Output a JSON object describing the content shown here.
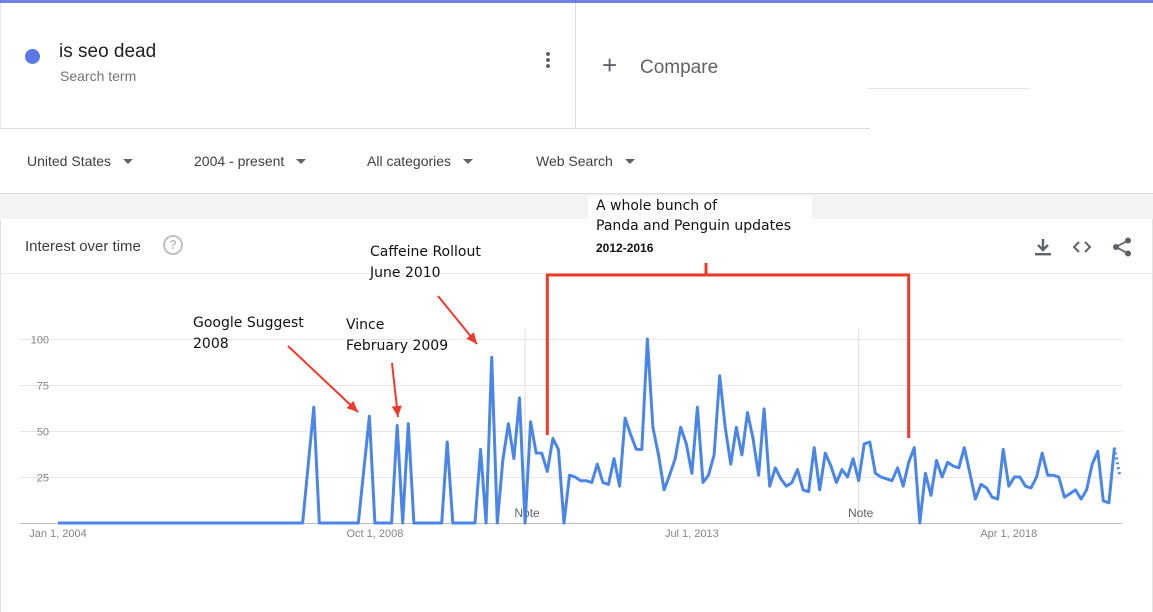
{
  "search_term": {
    "title": "is seo dead",
    "subtitle": "Search term",
    "color": "#5a79e6",
    "menu_icon": "more-vert-icon"
  },
  "compare": {
    "label": "Compare",
    "icon": "plus-icon"
  },
  "filters": [
    {
      "label": "United States"
    },
    {
      "label": "2004 - present"
    },
    {
      "label": "All categories"
    },
    {
      "label": "Web Search"
    }
  ],
  "card": {
    "title": "Interest over time",
    "help_icon": "help-icon",
    "tools": [
      "download-icon",
      "embed-code-icon",
      "share-icon"
    ]
  },
  "annotations": {
    "google_suggest": [
      "Google Suggest",
      "2008"
    ],
    "vince": [
      "Vince",
      "February 2009"
    ],
    "caffeine": [
      "Caffeine Rollout",
      "June 2010"
    ],
    "panda": [
      "A whole bunch of",
      "Panda and Penguin updates"
    ],
    "panda_years": "2012-2016",
    "arrow_color": "#ee3a2a"
  },
  "chart_data": {
    "type": "line",
    "title": "",
    "xlabel": "",
    "ylabel": "",
    "ylim": [
      0,
      100
    ],
    "y_ticks": [
      25,
      50,
      75,
      100
    ],
    "x_ticks": [
      "Jan 1, 2004",
      "Oct 1, 2008",
      "Jul 1, 2013",
      "Apr 1, 2018"
    ],
    "x_range": [
      "2004-01",
      "2019-05"
    ],
    "grid": true,
    "line_color": "#4a86e8",
    "notes": [
      {
        "label": "Note",
        "date": "2011-01"
      },
      {
        "label": "Note",
        "date": "2016-01"
      }
    ],
    "series": [
      {
        "points": [
          [
            "2004-01",
            0
          ],
          [
            "2007-09",
            0
          ],
          [
            "2007-11",
            63
          ],
          [
            "2007-12",
            0
          ],
          [
            "2008-07",
            0
          ],
          [
            "2008-09",
            58
          ],
          [
            "2008-10",
            0
          ],
          [
            "2009-01",
            0
          ],
          [
            "2009-02",
            53
          ],
          [
            "2009-03",
            0
          ],
          [
            "2009-04",
            54
          ],
          [
            "2009-05",
            0
          ],
          [
            "2009-10",
            0
          ],
          [
            "2009-11",
            44
          ],
          [
            "2009-12",
            0
          ],
          [
            "2010-04",
            0
          ],
          [
            "2010-05",
            40
          ],
          [
            "2010-06",
            0
          ],
          [
            "2010-07",
            90
          ],
          [
            "2010-08",
            0
          ],
          [
            "2010-09",
            34
          ],
          [
            "2010-10",
            54
          ],
          [
            "2010-11",
            35
          ],
          [
            "2010-12",
            68
          ],
          [
            "2011-01",
            0
          ],
          [
            "2011-02",
            55
          ],
          [
            "2011-03",
            38
          ],
          [
            "2011-04",
            38
          ],
          [
            "2011-05",
            28
          ],
          [
            "2011-06",
            46
          ],
          [
            "2011-07",
            40
          ],
          [
            "2011-08",
            0
          ],
          [
            "2011-09",
            26
          ],
          [
            "2011-10",
            25
          ],
          [
            "2011-11",
            23
          ],
          [
            "2011-12",
            23
          ],
          [
            "2012-01",
            22
          ],
          [
            "2012-02",
            32
          ],
          [
            "2012-03",
            22
          ],
          [
            "2012-04",
            21
          ],
          [
            "2012-05",
            35
          ],
          [
            "2012-06",
            20
          ],
          [
            "2012-07",
            57
          ],
          [
            "2012-08",
            48
          ],
          [
            "2012-09",
            40
          ],
          [
            "2012-10",
            40
          ],
          [
            "2012-11",
            100
          ],
          [
            "2012-12",
            52
          ],
          [
            "2013-01",
            37
          ],
          [
            "2013-02",
            18
          ],
          [
            "2013-03",
            26
          ],
          [
            "2013-04",
            35
          ],
          [
            "2013-05",
            52
          ],
          [
            "2013-06",
            43
          ],
          [
            "2013-07",
            27
          ],
          [
            "2013-08",
            63
          ],
          [
            "2013-09",
            22
          ],
          [
            "2013-10",
            26
          ],
          [
            "2013-11",
            37
          ],
          [
            "2013-12",
            80
          ],
          [
            "2014-01",
            52
          ],
          [
            "2014-02",
            32
          ],
          [
            "2014-03",
            52
          ],
          [
            "2014-04",
            37
          ],
          [
            "2014-05",
            60
          ],
          [
            "2014-06",
            46
          ],
          [
            "2014-07",
            26
          ],
          [
            "2014-08",
            62
          ],
          [
            "2014-09",
            20
          ],
          [
            "2014-10",
            30
          ],
          [
            "2014-11",
            24
          ],
          [
            "2014-12",
            20
          ],
          [
            "2015-01",
            22
          ],
          [
            "2015-02",
            29
          ],
          [
            "2015-03",
            18
          ],
          [
            "2015-04",
            17
          ],
          [
            "2015-05",
            41
          ],
          [
            "2015-06",
            18
          ],
          [
            "2015-07",
            38
          ],
          [
            "2015-08",
            31
          ],
          [
            "2015-09",
            22
          ],
          [
            "2015-10",
            29
          ],
          [
            "2015-11",
            25
          ],
          [
            "2015-12",
            35
          ],
          [
            "2016-01",
            23
          ],
          [
            "2016-02",
            43
          ],
          [
            "2016-03",
            44
          ],
          [
            "2016-04",
            27
          ],
          [
            "2016-05",
            25
          ],
          [
            "2016-06",
            24
          ],
          [
            "2016-07",
            23
          ],
          [
            "2016-08",
            30
          ],
          [
            "2016-09",
            20
          ],
          [
            "2016-10",
            33
          ],
          [
            "2016-11",
            41
          ],
          [
            "2016-12",
            0
          ],
          [
            "2017-01",
            27
          ],
          [
            "2017-02",
            15
          ],
          [
            "2017-03",
            34
          ],
          [
            "2017-04",
            25
          ],
          [
            "2017-05",
            33
          ],
          [
            "2017-06",
            31
          ],
          [
            "2017-07",
            30
          ],
          [
            "2017-08",
            41
          ],
          [
            "2017-09",
            27
          ],
          [
            "2017-10",
            13
          ],
          [
            "2017-11",
            21
          ],
          [
            "2017-12",
            19
          ],
          [
            "2018-01",
            14
          ],
          [
            "2018-02",
            13
          ],
          [
            "2018-03",
            40
          ],
          [
            "2018-04",
            20
          ],
          [
            "2018-05",
            25
          ],
          [
            "2018-06",
            25
          ],
          [
            "2018-07",
            20
          ],
          [
            "2018-08",
            19
          ],
          [
            "2018-09",
            25
          ],
          [
            "2018-10",
            38
          ],
          [
            "2018-11",
            26
          ],
          [
            "2018-12",
            26
          ],
          [
            "2019-01",
            25
          ],
          [
            "2019-02",
            14
          ],
          [
            "2019-03",
            16
          ],
          [
            "2019-04",
            18
          ],
          [
            "2019-05",
            13
          ],
          [
            "2019-06",
            18
          ],
          [
            "2019-07",
            32
          ],
          [
            "2019-08",
            39
          ],
          [
            "2019-09",
            12
          ],
          [
            "2019-10",
            11
          ],
          [
            "2019-11",
            41
          ],
          [
            "2019-12",
            25
          ]
        ]
      }
    ]
  }
}
